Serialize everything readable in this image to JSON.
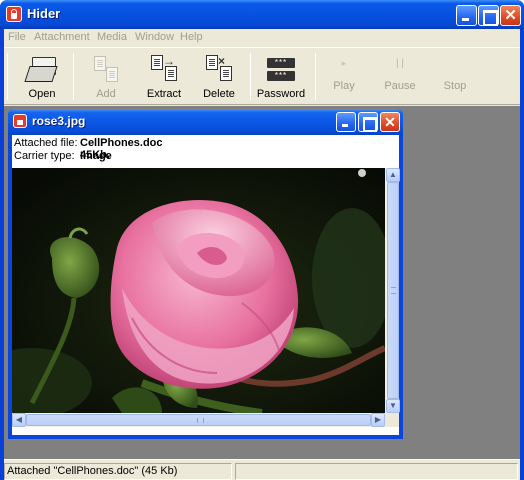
{
  "app": {
    "title": "Hider"
  },
  "menu": {
    "items": [
      "File",
      "Attachment",
      "Media",
      "Window",
      "Help"
    ]
  },
  "toolbar": {
    "open_label": "Open",
    "add_label": "Add",
    "extract_label": "Extract",
    "delete_label": "Delete",
    "password_label": "Password",
    "play_label": "Play",
    "pause_label": "Pause",
    "stop_label": "Stop",
    "password_mask": "***"
  },
  "document": {
    "title": "rose3.jpg",
    "attached_label": "Attached file:",
    "attached_value": "CellPhones.doc  45Kb.",
    "carrier_label": "Carrier type:",
    "carrier_value": "Image"
  },
  "statusbar": {
    "message": "Attached \"CellPhones.doc\" (45 Kb)"
  },
  "icons": {
    "close": "close-icon",
    "minimize": "minimize-icon",
    "maximize": "maximize-icon"
  },
  "colors": {
    "titlebar": "#0b5ae9",
    "close_button": "#df4a25",
    "mdi_background": "#808080",
    "dialog_face": "#ece9d8"
  }
}
